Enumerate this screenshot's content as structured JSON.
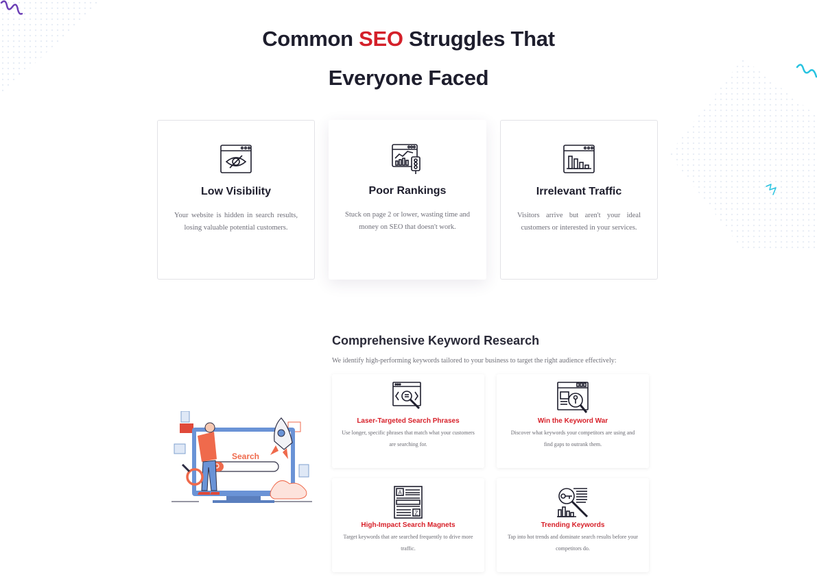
{
  "heading": {
    "line1_before": "Common ",
    "line1_accent": "SEO",
    "line1_after": " Struggles That",
    "line2": "Everyone Faced"
  },
  "struggles": [
    {
      "icon": "hidden-eye-icon",
      "title": "Low Visibility",
      "text": "Your website is hidden in search results, losing valuable potential customers."
    },
    {
      "icon": "ranking-chart-icon",
      "title": "Poor Rankings",
      "text": "Stuck on page 2 or lower, wasting time and money on SEO that doesn't work."
    },
    {
      "icon": "traffic-chart-icon",
      "title": "Irrelevant Traffic",
      "text": "Visitors arrive but aren't your ideal customers or interested in your services."
    }
  ],
  "keyword_research": {
    "title": "Comprehensive Keyword Research",
    "description": "We identify high-performing keywords tailored to your business to target the right audience effectively:",
    "illustration_text": "Search",
    "features": [
      {
        "icon": "search-phrase-icon",
        "title": "Laser-Targeted Search Phrases",
        "text": "Use longer, specific phrases that match what your customers are searching for."
      },
      {
        "icon": "keyword-war-icon",
        "title": "Win the Keyword War",
        "text": "Discover what keywords your competitors are using and find gaps to outrank them."
      },
      {
        "icon": "search-magnet-icon",
        "title": "High-Impact Search Magnets",
        "text": "Target keywords that are searched frequently to drive more traffic."
      },
      {
        "icon": "trending-key-icon",
        "title": "Trending Keywords",
        "text": "Tap into hot trends and dominate search results before your competitors do."
      }
    ]
  },
  "colors": {
    "accent": "#d4202a",
    "dark": "#1e1e2d",
    "purple": "#6c3fb6",
    "cyan": "#27c3e0"
  }
}
